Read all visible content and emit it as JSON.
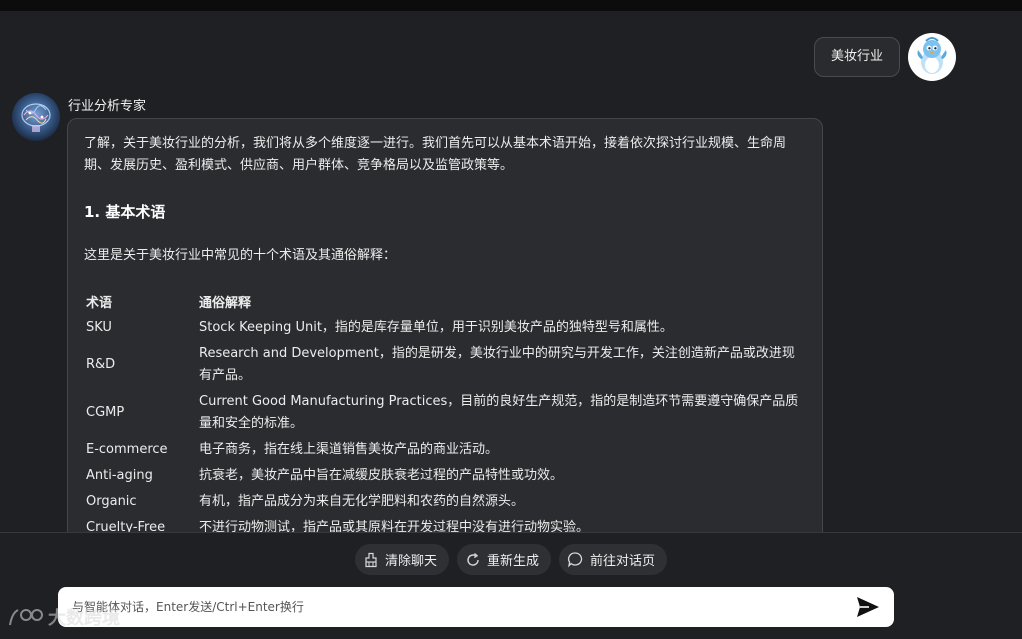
{
  "user_message": {
    "text": "美妆行业"
  },
  "assistant": {
    "name": "行业分析专家",
    "intro": "了解，关于美妆行业的分析，我们将从多个维度逐一进行。我们首先可以从基本术语开始，接着依次探讨行业规模、生命周期、发展历史、盈利模式、供应商、用户群体、竞争格局以及监管政策等。",
    "section_title": "1. 基本术语",
    "section_desc": "这里是关于美妆行业中常见的十个术语及其通俗解释：",
    "table": {
      "headers": [
        "术语",
        "通俗解释"
      ],
      "rows": [
        [
          "SKU",
          "Stock Keeping Unit，指的是库存量单位，用于识别美妆产品的独特型号和属性。"
        ],
        [
          "R&D",
          "Research and Development，指的是研发，美妆行业中的研究与开发工作，关注创造新产品或改进现有产品。"
        ],
        [
          "CGMP",
          "Current Good Manufacturing Practices，目前的良好生产规范，指的是制造环节需要遵守确保产品质量和安全的标准。"
        ],
        [
          "E-commerce",
          "电子商务，指在线上渠道销售美妆产品的商业活动。"
        ],
        [
          "Anti-aging",
          "抗衰老，美妆产品中旨在减缓皮肤衰老过程的产品特性或功效。"
        ],
        [
          "Organic",
          "有机，指产品成分为来自无化学肥料和农药的自然源头。"
        ],
        [
          "Cruelty-Free",
          "不进行动物测试，指产品或其原料在开发过程中没有进行动物实验。"
        ]
      ]
    }
  },
  "actions": {
    "clear": {
      "label": "清除聊天",
      "icon": "broom-icon"
    },
    "regenerate": {
      "label": "重新生成",
      "icon": "refresh-icon"
    },
    "goto": {
      "label": "前往对话页",
      "icon": "chat-bubble-icon"
    }
  },
  "input": {
    "placeholder": "与智能体对话，Enter发送/Ctrl+Enter换行",
    "value": ""
  },
  "watermark": {
    "text": "大数跨境"
  },
  "colors": {
    "background": "#1f2023",
    "bubble": "#2b2c30",
    "input": "#ffffff"
  }
}
